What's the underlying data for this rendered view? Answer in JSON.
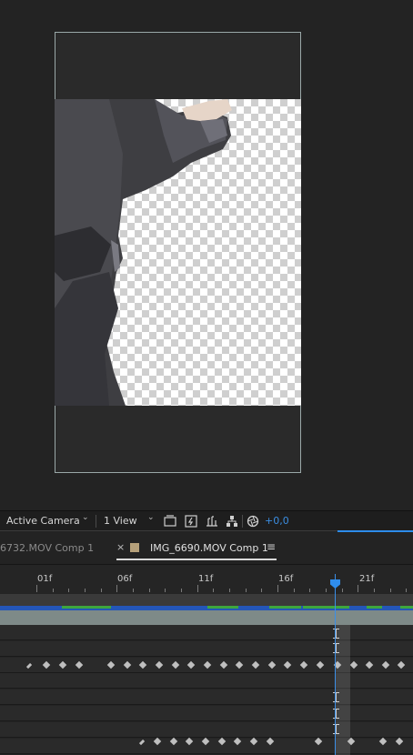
{
  "viewer_toolbar": {
    "camera_label": "Active Camera",
    "view_label": "1 View",
    "exposure_value": "+0,0",
    "icons": [
      "fast-previews-icon",
      "toggle-transparency-grid-icon",
      "region-of-interest-icon",
      "flowchart-icon",
      "reset-exposure-icon"
    ]
  },
  "timeline": {
    "tabs": {
      "previous_label": "6732.MOV Comp 1",
      "close_glyph": "×",
      "active_label": "IMG_6690.MOV Comp 1",
      "menu_glyph": "≡"
    },
    "ruler_labels": [
      "01f",
      "06f",
      "11f",
      "16f",
      "21f"
    ]
  },
  "colors": {
    "accent": "#2d8ceb",
    "tab_swatch": "#b5a07a",
    "cache_blue": "#2456b8",
    "cache_green": "#3ea63e"
  }
}
